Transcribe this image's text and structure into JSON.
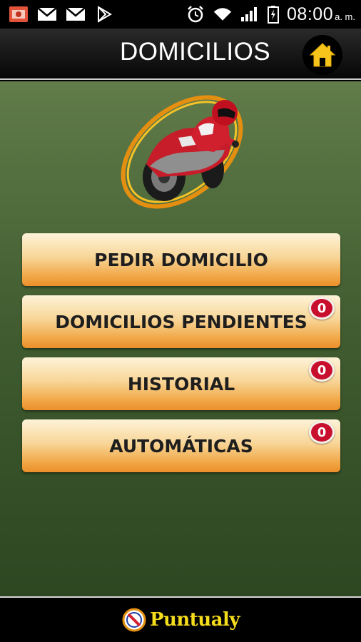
{
  "status_bar": {
    "time": "08:00",
    "ampm": "a. m.",
    "icons": [
      "photo-notification-icon",
      "gmail-icon",
      "gmail-icon",
      "play-store-icon",
      "alarm-icon",
      "wifi-icon",
      "signal-icon",
      "battery-icon"
    ]
  },
  "header": {
    "title": "DOMICILIOS",
    "home_icon": "home-icon"
  },
  "logo": {
    "icon": "motorcycle-courier-logo"
  },
  "menu": [
    {
      "label": "PEDIR DOMICILIO"
    },
    {
      "label": "DOMICILIOS PENDIENTES",
      "badge": "0"
    },
    {
      "label": "HISTORIAL",
      "badge": "0"
    },
    {
      "label": "AUTOMÁTICAS",
      "badge": "0"
    }
  ],
  "footer": {
    "brand": "Puntualy",
    "brand_icon": "puntualy-logo-icon"
  },
  "colors": {
    "background_top": "#617c49",
    "background_bottom": "#2d4722",
    "button_orange": "#f1a949",
    "badge_red": "#c8102e",
    "brand_yellow": "#f5dd1c",
    "home_yellow": "#f7c41b"
  }
}
